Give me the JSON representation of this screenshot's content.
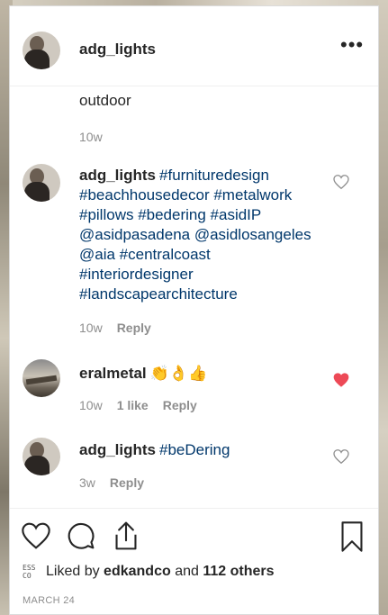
{
  "header": {
    "username": "adg_lights",
    "more_icon": "ellipsis-icon"
  },
  "comments": [
    {
      "text": "outdoor",
      "time": "10w"
    },
    {
      "username": "adg_lights",
      "lines": [
        "#furnituredesign",
        "#beachhousedecor #metalwork",
        "#pillows #bedering #asidIP",
        "@asidpasadena @asidlosangeles",
        "@aia #centralcoast",
        "#interiordesigner",
        "#landscapearchitecture"
      ],
      "time": "10w",
      "reply": "Reply",
      "liked": false
    },
    {
      "username": "eralmetal",
      "emoji": "👏👌👍",
      "time": "10w",
      "likes": "1 like",
      "reply": "Reply",
      "liked": true
    },
    {
      "username": "adg_lights",
      "text": "#beDering",
      "time": "3w",
      "reply": "Reply",
      "liked": false
    }
  ],
  "actions": {
    "like_icon": "heart-outline-icon",
    "comment_icon": "comment-bubble-icon",
    "share_icon": "share-upload-icon",
    "save_icon": "bookmark-icon"
  },
  "likes": {
    "prefix": "Liked by",
    "user": "edkandco",
    "joiner": "and",
    "others": "112 others"
  },
  "date": "MARCH 24",
  "colors": {
    "liked_heart": "#ed4956",
    "hashtag": "#00376b",
    "meta": "#8e8e8e"
  }
}
